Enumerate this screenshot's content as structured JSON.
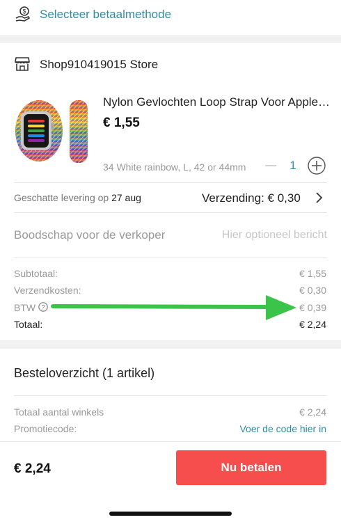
{
  "payment": {
    "label": "Selecteer betaalmethode",
    "icon": "hand-coin-icon"
  },
  "store": {
    "name": "Shop910419015 Store",
    "icon": "store-icon"
  },
  "product": {
    "title": "Nylon Gevlochten Loop Strap Voor Apple Watch Band",
    "price": "€ 1,55",
    "variant": "34 White rainbow, L, 42 or 44mm",
    "quantity": "1"
  },
  "delivery": {
    "prefix": "Geschatte levering op",
    "date": "27 aug",
    "shipping": "Verzending: € 0,30"
  },
  "message": {
    "label": "Boodschap voor de verkoper",
    "placeholder": "Hier optioneel bericht"
  },
  "summary": {
    "subtotal_label": "Subtotaal:",
    "subtotal_value": "€ 1,55",
    "shipping_label": "Verzendkosten:",
    "shipping_value": "€ 0,30",
    "vat_label": "BTW",
    "vat_value": "€ 0,39",
    "total_label": "Totaal:",
    "total_value": "€ 2,24"
  },
  "overview": {
    "title": "Besteloverzicht (1 artikel)",
    "stores_total_label": "Totaal aantal winkels",
    "stores_total_value": "€ 2,24",
    "promo_label": "Promotiecode:",
    "promo_link": "Voer de code hier in"
  },
  "footer": {
    "price": "€ 2,24",
    "pay_button": "Nu betalen"
  },
  "colors": {
    "accent": "#2f8da3",
    "pay_button": "#f64d4d",
    "arrow": "#3cc44a"
  }
}
